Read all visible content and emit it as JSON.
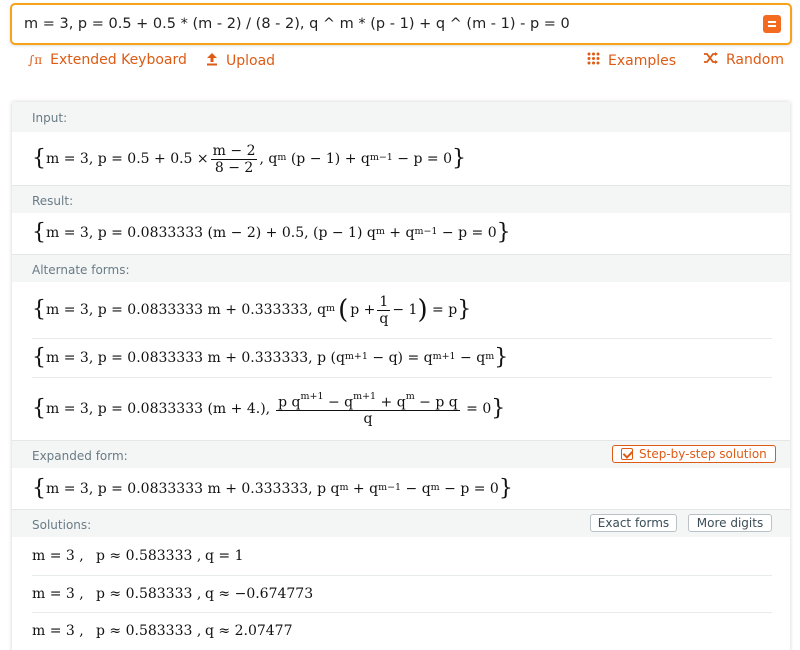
{
  "query": {
    "value": "m = 3, p = 0.5 + 0.5 * (m - 2) / (8 - 2), q ^ m * (p - 1) + q ^ (m - 1) - p = 0",
    "go_icon": "equals-icon"
  },
  "toolbar": {
    "extended_keyboard": "Extended Keyboard",
    "upload": "Upload",
    "examples": "Examples",
    "random": "Random"
  },
  "pods": {
    "input": {
      "title": "Input:"
    },
    "result": {
      "title": "Result:"
    },
    "alternate": {
      "title": "Alternate forms:"
    },
    "expanded": {
      "title": "Expanded form:",
      "step_button": "Step-by-step solution"
    },
    "solutions": {
      "title": "Solutions:",
      "exact_button": "Exact forms",
      "digits_button": "More digits",
      "rows": [
        {
          "m": "m = 3 ,",
          "p": "p ≈ 0.583333 ,",
          "q": "q = 1"
        },
        {
          "m": "m = 3 ,",
          "p": "p ≈ 0.583333 ,",
          "q": "q ≈ −0.674773"
        },
        {
          "m": "m = 3 ,",
          "p": "p ≈ 0.583333 ,",
          "q": "q ≈ 2.07477"
        }
      ]
    }
  },
  "math": {
    "input_pre": "m = 3, p = 0.5 + 0.5 ×",
    "input_num": "m − 2",
    "input_den": "8 − 2",
    "input_post_q": ", q",
    "input_sup1": "m",
    "input_mid": " (p − 1) + q",
    "input_sup2": "m−1",
    "input_end": " − p = 0",
    "result_a": "m = 3, p = 0.0833333 (m − 2) + 0.5, (p − 1) q",
    "result_sup1": "m",
    "result_b": " + q",
    "result_sup2": "m−1",
    "result_c": " − p = 0",
    "alt1_a": "m = 3, p = 0.0833333 m + 0.333333, q",
    "alt1_sup": "m",
    "alt1_b": "p +",
    "alt1_num": "1",
    "alt1_den": "q",
    "alt1_c": "− 1",
    "alt1_d": " = p",
    "alt2_a": "m = 3, p = 0.0833333 m + 0.333333, p (q",
    "alt2_sup1": "m+1",
    "alt2_b": " − q) = q",
    "alt2_sup2": "m+1",
    "alt2_c": " − q",
    "alt2_sup3": "m",
    "alt3_a": "m = 3, p = 0.0833333 (m + 4.),",
    "alt3_num_a": "p q",
    "alt3_num_s1": "m+1",
    "alt3_num_b": " − q",
    "alt3_num_s2": "m+1",
    "alt3_num_c": " + q",
    "alt3_num_s3": "m",
    "alt3_num_d": " − p q",
    "alt3_den": "q",
    "alt3_b": " = 0",
    "exp_a": "m = 3, p = 0.0833333 m + 0.333333, p q",
    "exp_sup1": "m",
    "exp_b": " + q",
    "exp_sup2": "m−1",
    "exp_c": " − q",
    "exp_sup3": "m",
    "exp_d": " − p = 0"
  }
}
